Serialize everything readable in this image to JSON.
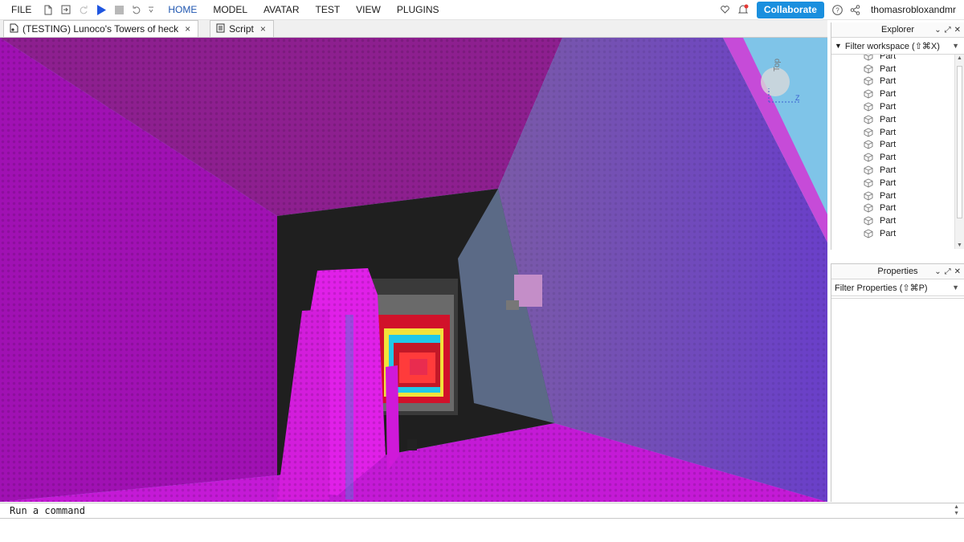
{
  "menubar": {
    "items": [
      {
        "label": "FILE"
      },
      {
        "label": "HOME"
      },
      {
        "label": "MODEL"
      },
      {
        "label": "AVATAR"
      },
      {
        "label": "TEST"
      },
      {
        "label": "VIEW"
      },
      {
        "label": "PLUGINS"
      }
    ],
    "active": "HOME",
    "collaborate_label": "Collaborate",
    "username": "thomasrobloxandmr",
    "accent_color": "#1a8fde"
  },
  "tabs": [
    {
      "label": "(TESTING) Lunoco's Towers of heck",
      "icon": "place-file-icon",
      "close": "×"
    },
    {
      "label": "Script",
      "icon": "script-icon",
      "close": "×"
    }
  ],
  "viewport": {
    "view_cube": {
      "top_label": "Top",
      "axis_label": "Z"
    }
  },
  "explorer": {
    "title": "Explorer",
    "filter_placeholder": "Filter workspace (⇧⌘X)",
    "items": [
      "Part",
      "Part",
      "Part",
      "Part",
      "Part",
      "Part",
      "Part",
      "Part",
      "Part",
      "Part",
      "Part",
      "Part",
      "Part",
      "Part",
      "Part"
    ]
  },
  "properties": {
    "title": "Properties",
    "filter_placeholder": "Filter Properties (⇧⌘P)"
  },
  "command_bar": {
    "placeholder": "Run a command"
  }
}
